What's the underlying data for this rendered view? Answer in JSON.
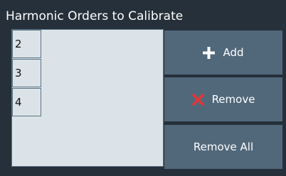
{
  "panel": {
    "title": "Harmonic Orders to Calibrate"
  },
  "list": {
    "items": [
      {
        "label": "2"
      },
      {
        "label": "3"
      },
      {
        "label": "4"
      }
    ]
  },
  "buttons": {
    "add": {
      "label": "Add",
      "icon": "plus-icon"
    },
    "remove": {
      "label": "Remove",
      "icon": "red-x-icon",
      "icon_color": "#e23636"
    },
    "remove_all": {
      "label": "Remove All"
    }
  },
  "colors": {
    "panel_background": "#26303a",
    "list_background": "#dbe3e8",
    "button_background": "#51687b",
    "border": "#5b7386"
  }
}
